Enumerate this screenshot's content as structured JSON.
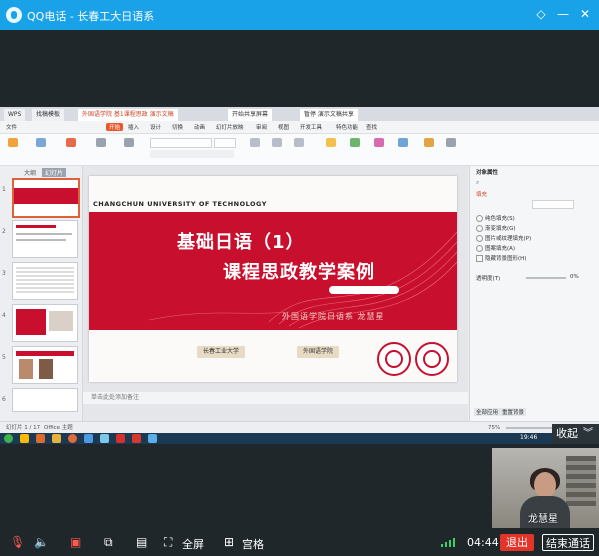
{
  "window": {
    "title": "QQ电话 - 长春工大日语系"
  },
  "shared_screen": {
    "tabs": [
      "WPS",
      "找稿模板",
      "外国语学院 基1课程思政 演示文稿"
    ],
    "center_tabs": [
      "开始共享屏幕",
      "暂停 演示文稿共享"
    ],
    "menus": [
      "文件",
      "开始",
      "插入",
      "设计",
      "切换",
      "动画",
      "幻灯片放映",
      "审阅",
      "视图",
      "开发工具",
      "特色功能",
      "查找"
    ],
    "active_menu": "开始",
    "left_panel_tabs": [
      "大纲",
      "幻灯片"
    ],
    "slide_numbers": [
      "1",
      "2",
      "3",
      "4",
      "5",
      "6"
    ],
    "notes_placeholder": "单击此处添加备注",
    "slide": {
      "school": "CHANGCHUN UNIVERSITY OF TECHNOLOGY",
      "title_line1": "基础日语（1）",
      "title_line2": "课程思政教学案例",
      "subtitle": "外国语学院日语系   龙慧星",
      "button1": "长春工业大学",
      "button2": "外国语学院",
      "accent": "#c8102e"
    },
    "right_pane": {
      "title": "对象属性",
      "section": "填充",
      "options": [
        "纯色填充(S)",
        "渐变填充(G)",
        "图片或纹理填充(P)",
        "图案填充(A)",
        "隐藏背景图形(H)"
      ],
      "transparency_label": "透明度(T)",
      "transparency_value": "0%",
      "footer_buttons": [
        "全部应用",
        "重置背景"
      ]
    },
    "status": {
      "slide_count": "幻灯片 1 / 17",
      "theme": "Office 主题",
      "zoom": "75%"
    },
    "taskbar_time": "19:46"
  },
  "collapse_button": "收起",
  "camera": {
    "participant_name": "龙慧星"
  },
  "bottombar": {
    "fullscreen_label": "全屏",
    "grid_label": "宫格",
    "timer": "04:44",
    "exit_label": "退出",
    "end_call_label": "结束通话"
  }
}
